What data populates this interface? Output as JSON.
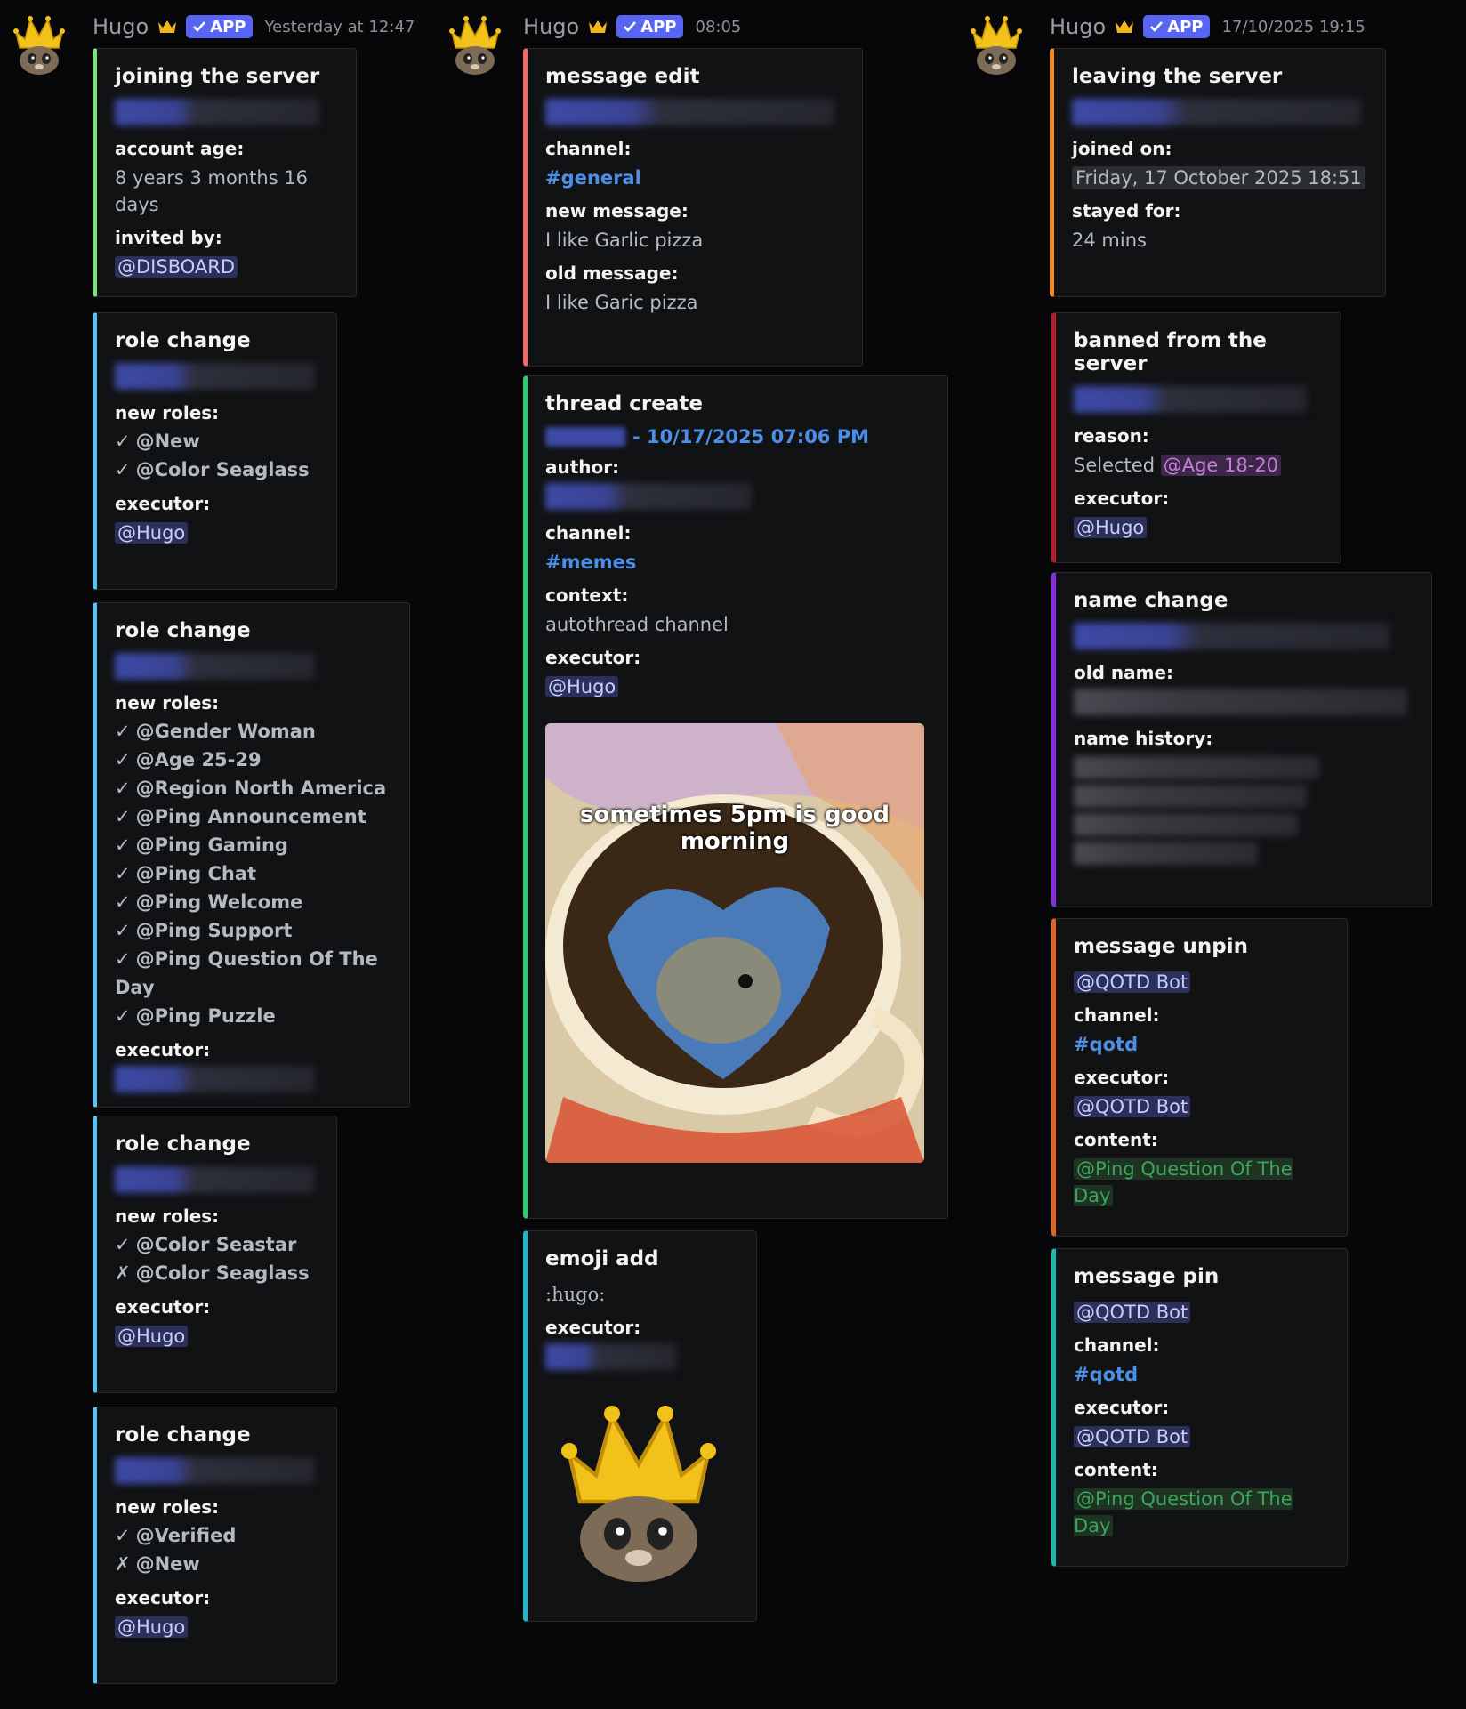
{
  "author": {
    "name": "Hugo",
    "badge": "APP"
  },
  "columns": [
    {
      "timestamp": "Yesterday at 12:47"
    },
    {
      "timestamp": "08:05"
    },
    {
      "timestamp": "17/10/2025 19:15"
    }
  ],
  "col1": {
    "join": {
      "title": "joining the server",
      "age_label": "account age:",
      "age_value": "8 years 3 months 16 days",
      "invited_label": "invited by:",
      "invited_value": "@DISBOARD"
    },
    "role1": {
      "title": "role change",
      "roles_label": "new roles:",
      "roles": [
        {
          "mark": "✓",
          "name": "@New"
        },
        {
          "mark": "✓",
          "name": "@Color Seaglass"
        }
      ],
      "executor_label": "executor:",
      "executor": "@Hugo"
    },
    "role2": {
      "title": "role change",
      "roles_label": "new roles:",
      "roles": [
        {
          "mark": "✓",
          "name": "@Gender Woman"
        },
        {
          "mark": "✓",
          "name": "@Age 25-29"
        },
        {
          "mark": "✓",
          "name": "@Region North America"
        },
        {
          "mark": "✓",
          "name": "@Ping Announcement"
        },
        {
          "mark": "✓",
          "name": "@Ping Gaming"
        },
        {
          "mark": "✓",
          "name": "@Ping Chat"
        },
        {
          "mark": "✓",
          "name": "@Ping Welcome"
        },
        {
          "mark": "✓",
          "name": "@Ping Support"
        },
        {
          "mark": "✓",
          "name": "@Ping Question Of The Day"
        },
        {
          "mark": "✓",
          "name": "@Ping Puzzle"
        }
      ],
      "executor_label": "executor:"
    },
    "role3": {
      "title": "role change",
      "roles_label": "new roles:",
      "roles": [
        {
          "mark": "✓",
          "name": "@Color Seastar"
        },
        {
          "mark": "✗",
          "name": "@Color Seaglass"
        }
      ],
      "executor_label": "executor:",
      "executor": "@Hugo"
    },
    "role4": {
      "title": "role change",
      "roles_label": "new roles:",
      "roles": [
        {
          "mark": "✓",
          "name": "@Verified"
        },
        {
          "mark": "✗",
          "name": "@New"
        }
      ],
      "executor_label": "executor:",
      "executor": "@Hugo"
    }
  },
  "col2": {
    "edit": {
      "title": "message edit",
      "channel_label": "channel:",
      "channel": "#general",
      "new_label": "new message:",
      "new_value": "I like Garlic pizza",
      "old_label": "old message:",
      "old_value": "I like Garic pizza"
    },
    "thread": {
      "title": "thread create",
      "date": "- 10/17/2025 07:06 PM",
      "author_label": "author:",
      "channel_label": "channel:",
      "channel": "#memes",
      "context_label": "context:",
      "context": "autothread channel",
      "executor_label": "executor:",
      "executor": "@Hugo",
      "image_caption": "sometimes 5pm is good morning"
    },
    "emoji": {
      "title": "emoji add",
      "name": ":hugo:",
      "executor_label": "executor:"
    }
  },
  "col3": {
    "leave": {
      "title": "leaving the server",
      "joined_label": "joined on:",
      "joined_value": "Friday, 17 October 2025 18:51",
      "stayed_label": "stayed for:",
      "stayed_value": "24 mins"
    },
    "ban": {
      "title": "banned from the server",
      "reason_label": "reason:",
      "reason_prefix": "Selected",
      "reason_role": "@Age 18-20",
      "executor_label": "executor:",
      "executor": "@Hugo"
    },
    "name": {
      "title": "name change",
      "old_label": "old name:",
      "history_label": "name history:"
    },
    "unpin": {
      "title": "message unpin",
      "who": "@QOTD Bot",
      "channel_label": "channel:",
      "channel": "#qotd",
      "executor_label": "executor:",
      "executor": "@QOTD Bot",
      "content_label": "content:",
      "content": "@Ping Question Of The Day"
    },
    "pin": {
      "title": "message pin",
      "who": "@QOTD Bot",
      "channel_label": "channel:",
      "channel": "#qotd",
      "executor_label": "executor:",
      "executor": "@QOTD Bot",
      "content_label": "content:",
      "content": "@Ping Question Of The Day"
    }
  },
  "colors": {
    "join": "#7ee07e",
    "role": "#5dc2f2",
    "edit": "#f06a6a",
    "thread": "#2ecc71",
    "emoji": "#1fb6c9",
    "leave": "#f08a24",
    "ban": "#b51e2e",
    "name": "#8a2be2",
    "unpin": "#e3641f",
    "pin": "#1fb6b0"
  }
}
